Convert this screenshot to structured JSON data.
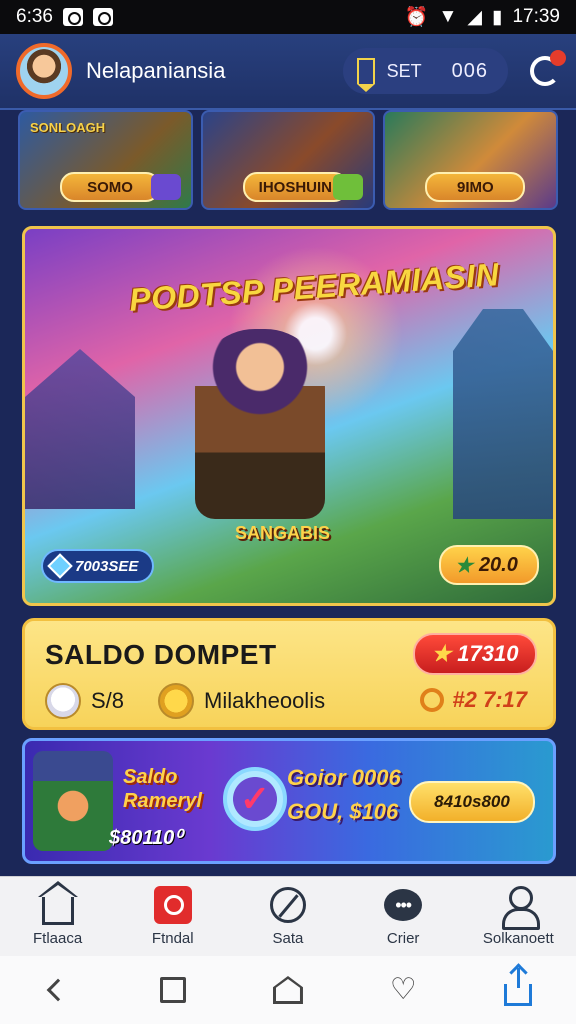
{
  "status_bar": {
    "time": "6:36",
    "clock": "17:39"
  },
  "header": {
    "username": "Nelapaniansia",
    "coin_label": "SET",
    "coin_value": "006"
  },
  "categories": [
    {
      "title": "SONLOAGH",
      "label": "SOMO"
    },
    {
      "title": "",
      "label": "IHOSHUIN"
    },
    {
      "title": "",
      "label": "9IMO"
    }
  ],
  "hero": {
    "title": "PODTSP PEERAMIASIN",
    "center_label": "SANGABIS",
    "left_pill": "7003SEE",
    "right_pill": "20.0"
  },
  "saldo": {
    "title": "SALDO DOMPET",
    "red_value": "17310",
    "row_value": "S/8",
    "row_label": "Milakheoolis",
    "right_value": "#2 7:17"
  },
  "promo": {
    "left_title_1": "Saldo",
    "left_title_2": "Rameryl",
    "left_amount": "$80110⁰",
    "mid_line_1": "Goior 0006",
    "mid_line_2": "GOU, $106",
    "button": "8410s800"
  },
  "bottom_nav": [
    "Ftlaaca",
    "Ftndal",
    "Sata",
    "Crier",
    "Solkanoett"
  ],
  "colors": {
    "accent": "#f0c54b",
    "header": "#28407e",
    "danger": "#e12c2c"
  }
}
